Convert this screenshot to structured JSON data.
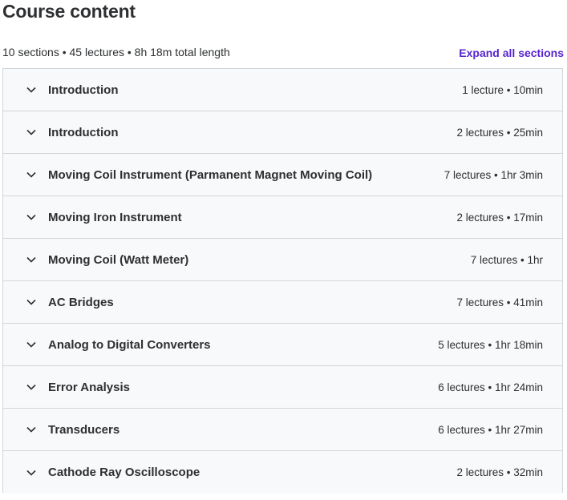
{
  "header": {
    "title": "Course content",
    "summary": "10 sections • 45 lectures • 8h 18m total length",
    "expand_all_label": "Expand all sections"
  },
  "colors": {
    "accent": "#5624d0",
    "row_background": "#f7f9fa",
    "border": "#d1d7dc",
    "text": "#2d2f31"
  },
  "sections": [
    {
      "title": "Introduction",
      "meta": "1 lecture • 10min",
      "icon": "chevron-down-icon"
    },
    {
      "title": "Introduction",
      "meta": "2 lectures • 25min",
      "icon": "chevron-down-icon"
    },
    {
      "title": "Moving Coil Instrument (Parmanent Magnet Moving Coil)",
      "meta": "7 lectures • 1hr 3min",
      "icon": "chevron-down-icon"
    },
    {
      "title": "Moving Iron Instrument",
      "meta": "2 lectures • 17min",
      "icon": "chevron-down-icon"
    },
    {
      "title": "Moving Coil (Watt Meter)",
      "meta": "7 lectures • 1hr",
      "icon": "chevron-down-icon"
    },
    {
      "title": "AC Bridges",
      "meta": "7 lectures • 41min",
      "icon": "chevron-down-icon"
    },
    {
      "title": "Analog to Digital Converters",
      "meta": "5 lectures • 1hr 18min",
      "icon": "chevron-down-icon"
    },
    {
      "title": "Error Analysis",
      "meta": "6 lectures • 1hr 24min",
      "icon": "chevron-down-icon"
    },
    {
      "title": "Transducers",
      "meta": "6 lectures • 1hr 27min",
      "icon": "chevron-down-icon"
    },
    {
      "title": "Cathode Ray Oscilloscope",
      "meta": "2 lectures • 32min",
      "icon": "chevron-down-icon"
    }
  ]
}
